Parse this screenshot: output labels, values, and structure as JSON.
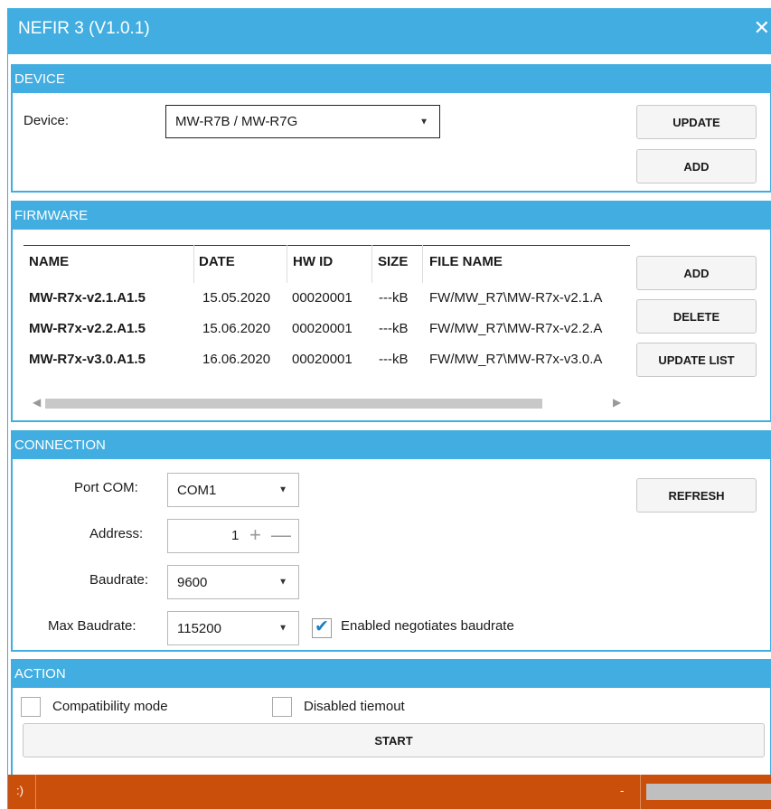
{
  "window": {
    "title": "NEFIR 3 (V1.0.1)",
    "close_glyph": "✕"
  },
  "device": {
    "header": "DEVICE",
    "label": "Device:",
    "selected": "MW-R7B / MW-R7G",
    "update_label": "UPDATE",
    "add_label": "ADD"
  },
  "firmware": {
    "header": "FIRMWARE",
    "columns": [
      "NAME",
      "DATE",
      "HW ID",
      "SIZE",
      "FILE NAME"
    ],
    "rows": [
      [
        "MW-R7x-v2.1.A1.5",
        "15.05.2020",
        "00020001",
        "---kB",
        "FW/MW_R7\\MW-R7x-v2.1.A"
      ],
      [
        "MW-R7x-v2.2.A1.5",
        "15.06.2020",
        "00020001",
        "---kB",
        "FW/MW_R7\\MW-R7x-v2.2.A"
      ],
      [
        "MW-R7x-v3.0.A1.5",
        "16.06.2020",
        "00020001",
        "---kB",
        "FW/MW_R7\\MW-R7x-v3.0.A"
      ]
    ],
    "add_label": "ADD",
    "delete_label": "DELETE",
    "update_list_label": "UPDATE LIST"
  },
  "connection": {
    "header": "CONNECTION",
    "port_label": "Port COM:",
    "port_value": "COM1",
    "address_label": "Address:",
    "address_value": "1",
    "baudrate_label": "Baudrate:",
    "baudrate_value": "9600",
    "max_baudrate_label": "Max Baudrate:",
    "max_baudrate_value": "115200",
    "negotiate_label": "Enabled negotiates baudrate",
    "negotiate_checked": true,
    "refresh_label": "REFRESH"
  },
  "action": {
    "header": "ACTION",
    "compat_label": "Compatibility mode",
    "compat_checked": false,
    "timeout_label": "Disabled tiemout",
    "timeout_checked": false,
    "start_label": "START"
  },
  "statusbar": {
    "left_text": ":)",
    "right_text": "-",
    "color": "#c94f0b"
  }
}
